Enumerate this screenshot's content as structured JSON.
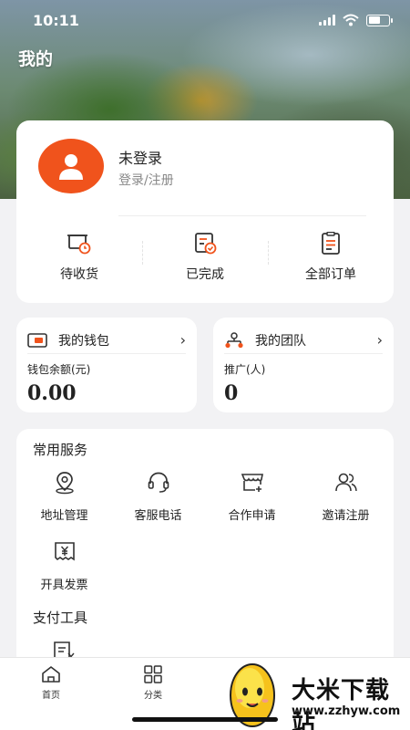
{
  "status_bar": {
    "time": "10:11"
  },
  "page": {
    "title": "我的"
  },
  "profile": {
    "name": "未登录",
    "login_link": "登录/注册"
  },
  "orders": [
    {
      "label": "待收货",
      "icon": "truck-clock-icon"
    },
    {
      "label": "已完成",
      "icon": "checklist-done-icon"
    },
    {
      "label": "全部订单",
      "icon": "order-list-icon"
    }
  ],
  "wallet": {
    "title": "我的钱包",
    "subtitle": "钱包余额(元)",
    "value": "0.00",
    "icon": "wallet-icon"
  },
  "team": {
    "title": "我的团队",
    "subtitle": "推广(人)",
    "value": "0",
    "icon": "team-tree-icon"
  },
  "common_services": {
    "title": "常用服务",
    "items": [
      {
        "label": "地址管理",
        "icon": "location-pin-icon"
      },
      {
        "label": "客服电话",
        "icon": "headset-icon"
      },
      {
        "label": "合作申请",
        "icon": "store-plus-icon"
      },
      {
        "label": "邀请注册",
        "icon": "users-icon"
      },
      {
        "label": "开具发票",
        "icon": "invoice-icon"
      }
    ]
  },
  "payment_tools": {
    "title": "支付工具",
    "icon": "receipt-yen-icon"
  },
  "tabbar": [
    {
      "label": "首页",
      "icon": "home-icon"
    },
    {
      "label": "分类",
      "icon": "grid-icon"
    }
  ],
  "watermark": {
    "name": "大米下载站",
    "url": "www.zzhyw.com"
  },
  "colors": {
    "accent": "#f0531c",
    "background": "#f2f2f4",
    "card": "#ffffff"
  }
}
